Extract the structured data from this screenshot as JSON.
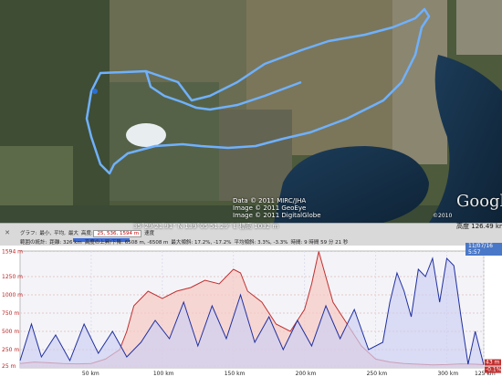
{
  "map": {
    "attribution_lines": [
      "Data © 2011 MIRC/JHA",
      "Image © 2011 GeoEye",
      "Image © 2011 DigitalGlobe"
    ],
    "coords": {
      "lat": "35°29'21.91\" N",
      "lon": "139°05'51.29\" E",
      "elev_label": "標高",
      "elev": "1032 m"
    },
    "brand": "Google",
    "year": "©2010",
    "altitude_label": "高度",
    "altitude": "126.49 km"
  },
  "panel": {
    "row1": [
      {
        "label": "グラフ:",
        "value": ""
      },
      {
        "label": "最小,",
        "value": ""
      },
      {
        "label": "平均,",
        "value": ""
      },
      {
        "label": "最大",
        "value": ""
      },
      {
        "label": "高度:",
        "value": "25, 536, 1594 m",
        "highlight": true
      },
      {
        "label": "速度",
        "value": ""
      }
    ],
    "row2": [
      {
        "label": "範囲の統計:",
        "value": ""
      },
      {
        "label": "距離:",
        "value": "326 km"
      },
      {
        "label": "高度の上昇/下降:",
        "value": "6508 m, -6508 m"
      },
      {
        "label": "最大傾斜:",
        "value": "17.2%, -17.2%"
      },
      {
        "label": "平均傾斜:",
        "value": "3.3%, -3.3%"
      },
      {
        "label": "時間:",
        "value": "9 時間 59 分 21 秒"
      }
    ]
  },
  "chart_data": {
    "type": "line",
    "date_label": "11/07/16 5:57",
    "ylim": [
      0,
      1600
    ],
    "yticks": [
      "1594 m",
      "1250 m",
      "1000 m",
      "750 m",
      "500 m",
      "250 m",
      "25 m"
    ],
    "ytick_values": [
      1594,
      1250,
      1000,
      750,
      500,
      250,
      25
    ],
    "xlim": [
      0,
      326
    ],
    "xticks": [
      "50 km",
      "100 km",
      "150 km",
      "200 km",
      "250 km",
      "300 km",
      "125 km"
    ],
    "xtick_values": [
      50,
      100,
      150,
      200,
      250,
      300,
      326
    ],
    "right_labels": [
      "43 m",
      "-0.1%"
    ],
    "series": [
      {
        "color": "#c03030",
        "fill": "#f7c9c3",
        "x": [
          0,
          10,
          20,
          30,
          40,
          50,
          60,
          70,
          75,
          80,
          90,
          100,
          110,
          120,
          130,
          140,
          150,
          155,
          160,
          170,
          180,
          190,
          200,
          205,
          210,
          220,
          230,
          240,
          250,
          260,
          270,
          280,
          290,
          300,
          310,
          320,
          326
        ],
        "y": [
          60,
          80,
          70,
          60,
          55,
          60,
          120,
          250,
          500,
          850,
          1050,
          950,
          1050,
          1100,
          1200,
          1150,
          1350,
          1300,
          1050,
          900,
          600,
          500,
          800,
          1150,
          1594,
          900,
          600,
          300,
          120,
          80,
          60,
          50,
          40,
          45,
          55,
          50,
          43
        ]
      },
      {
        "color": "#2030a0",
        "fill": "#cfd0f2",
        "x": [
          0,
          8,
          15,
          25,
          35,
          45,
          55,
          65,
          75,
          85,
          95,
          105,
          115,
          125,
          135,
          145,
          155,
          165,
          175,
          185,
          195,
          205,
          215,
          225,
          235,
          245,
          255,
          260,
          265,
          270,
          275,
          280,
          285,
          290,
          295,
          300,
          305,
          310,
          315,
          320,
          326
        ],
        "y": [
          100,
          600,
          150,
          450,
          100,
          600,
          200,
          500,
          150,
          350,
          650,
          400,
          900,
          300,
          850,
          400,
          1000,
          350,
          700,
          250,
          650,
          300,
          850,
          400,
          800,
          250,
          350,
          900,
          1300,
          1050,
          700,
          1350,
          1250,
          1500,
          900,
          1500,
          1400,
          700,
          50,
          500,
          40
        ]
      }
    ]
  }
}
